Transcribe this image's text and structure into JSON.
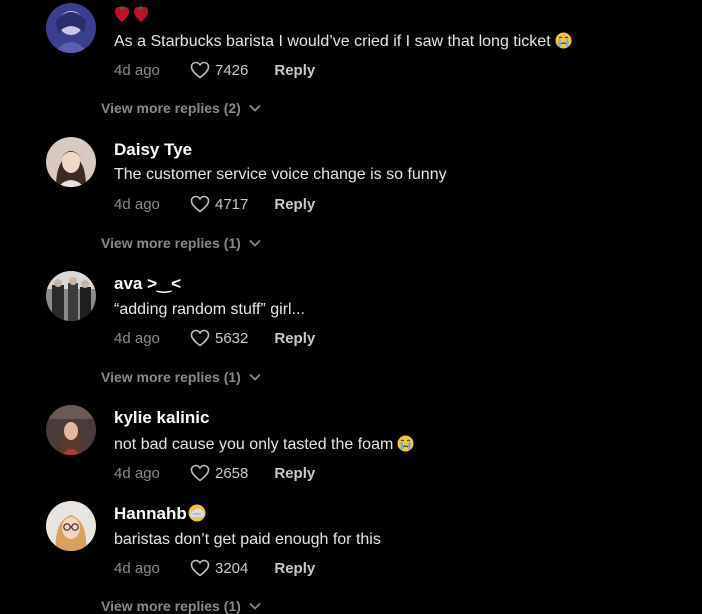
{
  "comments": [
    {
      "username_emojis": [
        "heart-emoji",
        "heart-emoji"
      ],
      "text": "As a Starbucks barista I would’ve cried if I saw that long ticket",
      "text_emoji": "crying-face-emoji",
      "time": "4d ago",
      "likes": "7426",
      "reply_label": "Reply",
      "more_replies": "View more replies (2)"
    },
    {
      "username": "Daisy Tye",
      "text": "The customer service voice change is so funny",
      "time": "4d ago",
      "likes": "4717",
      "reply_label": "Reply",
      "more_replies": "View more replies (1)"
    },
    {
      "username": "ava >‿<",
      "text": "“adding random stuff” girl...",
      "time": "4d ago",
      "likes": "5632",
      "reply_label": "Reply",
      "more_replies": "View more replies (1)"
    },
    {
      "username": "kylie kalinic",
      "text": "not bad cause you only tasted the foam",
      "text_emoji": "crying-face-emoji",
      "time": "4d ago",
      "likes": "2658",
      "reply_label": "Reply"
    },
    {
      "username": "Hannahb",
      "username_emoji": "face-in-clouds-emoji",
      "text": "baristas don’t get paid enough for this",
      "time": "4d ago",
      "likes": "3204",
      "reply_label": "Reply",
      "more_replies": "View more replies (1)"
    }
  ]
}
